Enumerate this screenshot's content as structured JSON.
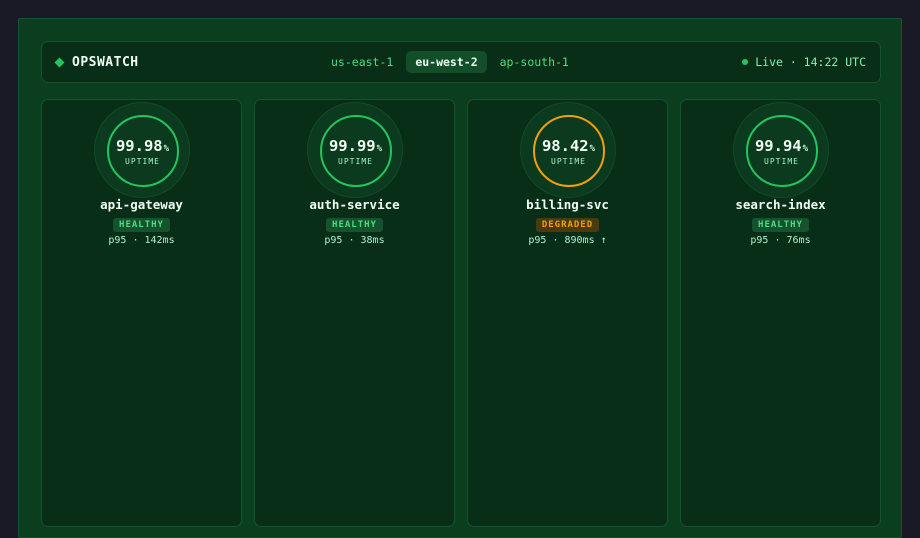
{
  "app": {
    "name": "OPSWATCH",
    "logo_icon": "diamond-icon"
  },
  "regions": [
    {
      "label": "us-east-1",
      "active": false
    },
    {
      "label": "eu-west-2",
      "active": true
    },
    {
      "label": "ap-south-1",
      "active": false
    }
  ],
  "status": {
    "text": "Live · 14:22 UTC",
    "indicator_color": "#22c55e"
  },
  "colors": {
    "healthy": "#22c55e",
    "degraded": "#f59e0b",
    "background": "#0b3d1f"
  },
  "services": [
    {
      "name": "api-gateway",
      "uptime": "99.98",
      "unit": "%",
      "uptime_label": "UPTIME",
      "status": "HEALTHY",
      "latency": "p95 · 142ms"
    },
    {
      "name": "auth-service",
      "uptime": "99.99",
      "unit": "%",
      "uptime_label": "UPTIME",
      "status": "HEALTHY",
      "latency": "p95 · 38ms"
    },
    {
      "name": "billing-svc",
      "uptime": "98.42",
      "unit": "%",
      "uptime_label": "UPTIME",
      "status": "DEGRADED",
      "latency": "p95 · 890ms ↑"
    },
    {
      "name": "search-index",
      "uptime": "99.94",
      "unit": "%",
      "uptime_label": "UPTIME",
      "status": "HEALTHY",
      "latency": "p95 · 76ms"
    }
  ]
}
